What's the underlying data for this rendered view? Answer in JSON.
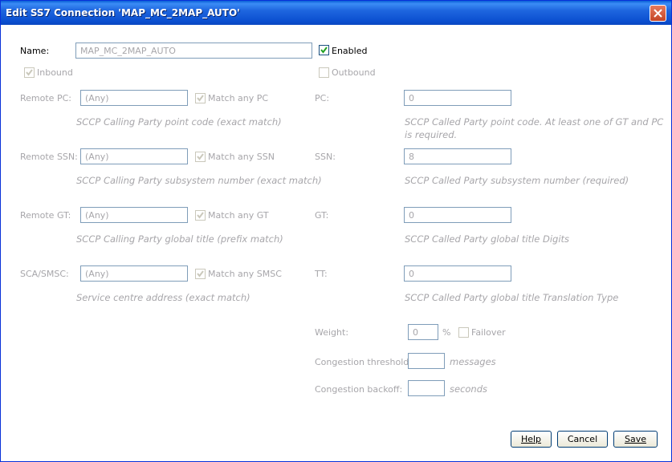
{
  "window": {
    "title": "Edit SS7 Connection 'MAP_MC_2MAP_AUTO'"
  },
  "form": {
    "name_label": "Name:",
    "name_value": "MAP_MC_2MAP_AUTO",
    "enabled_label": "Enabled",
    "enabled_checked": true,
    "inbound_label": "Inbound",
    "inbound_checked": true,
    "outbound_label": "Outbound",
    "outbound_checked": false
  },
  "left": [
    {
      "label": "Remote PC:",
      "value": "(Any)",
      "match_label": "Match any PC",
      "desc": "SCCP Calling Party point code (exact match)"
    },
    {
      "label": "Remote SSN:",
      "value": "(Any)",
      "match_label": "Match any SSN",
      "desc": "SCCP Calling Party subsystem number (exact match)"
    },
    {
      "label": "Remote GT:",
      "value": "(Any)",
      "match_label": "Match any GT",
      "desc": "SCCP Calling Party global title (prefix match)"
    },
    {
      "label": "SCA/SMSC:",
      "value": "(Any)",
      "match_label": "Match any SMSC",
      "desc": "Service centre address (exact match)"
    }
  ],
  "right": [
    {
      "label": "PC:",
      "value": "0",
      "desc_line1": "SCCP Called Party point code. At least one of GT and PC",
      "desc_line2": "is required."
    },
    {
      "label": "SSN:",
      "value": "8",
      "desc_line1": "SCCP Called Party subsystem number (required)"
    },
    {
      "label": "GT:",
      "value": "0",
      "desc_line1": "SCCP Called Party global title Digits"
    },
    {
      "label": "TT:",
      "value": "0",
      "desc_line1": "SCCP Called Party global title Translation Type"
    }
  ],
  "extra": {
    "weight_label": "Weight:",
    "weight_value": "0",
    "percent": "%",
    "failover_label": "Failover",
    "congestion_threshold_label": "Congestion threshold:",
    "congestion_threshold_value": "",
    "messages_unit": "messages",
    "congestion_backoff_label": "Congestion backoff:",
    "congestion_backoff_value": "",
    "seconds_unit": "seconds"
  },
  "buttons": {
    "help": "Help",
    "cancel": "Cancel",
    "save": "Save"
  }
}
